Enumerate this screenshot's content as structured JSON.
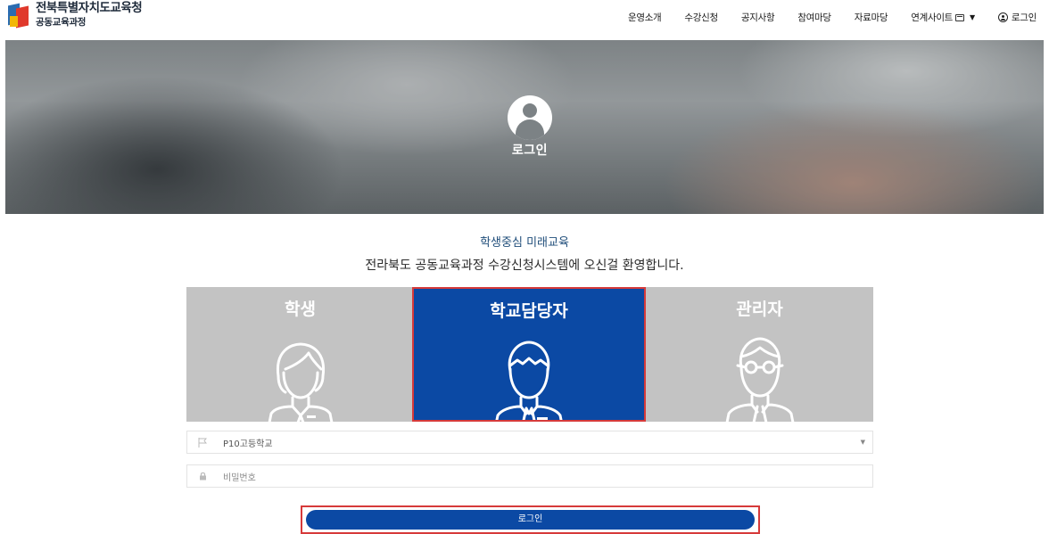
{
  "header": {
    "logo_title": "전북특별자치도교육청",
    "logo_sub": "공동교육과정",
    "nav": [
      {
        "label": "운영소개"
      },
      {
        "label": "수강신청"
      },
      {
        "label": "공지사항"
      },
      {
        "label": "참여마당"
      },
      {
        "label": "자료마당"
      },
      {
        "label": "연계사이트",
        "icon": "external-window-icon",
        "has_dropdown": true
      },
      {
        "label": "로그인",
        "icon": "user-circle-icon"
      }
    ]
  },
  "hero": {
    "icon": "user-circle-icon",
    "title": "로그인"
  },
  "welcome": {
    "line1": "학생중심 미래교육",
    "line2": "전라북도 공동교육과정 수강신청시스템에 오신걸 환영합니다."
  },
  "roles": [
    {
      "label": "학생",
      "icon": "female-student-icon",
      "selected": false
    },
    {
      "label": "학교담당자",
      "icon": "male-staff-icon",
      "selected": true
    },
    {
      "label": "관리자",
      "icon": "male-admin-glasses-icon",
      "selected": false
    }
  ],
  "form": {
    "school_select": {
      "value": "P10고등학교",
      "icon": "flag-icon"
    },
    "password": {
      "placeholder": "비밀번호",
      "icon": "lock-icon"
    },
    "login_button": "로그인"
  },
  "colors": {
    "primary": "#0b49a4",
    "role_inactive": "#c3c3c3",
    "highlight_border": "#d63a3a",
    "welcome_line1": "#1f4d7a"
  }
}
